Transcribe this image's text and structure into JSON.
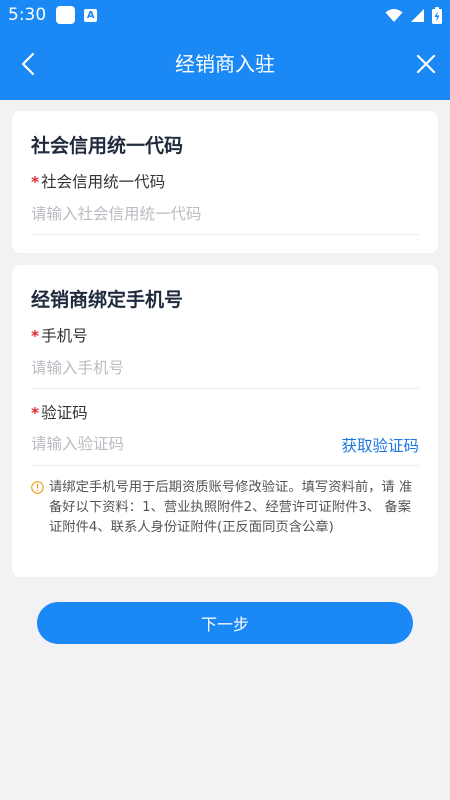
{
  "status_bar": {
    "time": "5:30",
    "app_a_label": "A"
  },
  "header": {
    "title": "经销商入驻"
  },
  "credit_section": {
    "title": "社会信用统一代码",
    "required_mark": "*",
    "field_label": "社会信用统一代码",
    "field_placeholder": "请输入社会信用统一代码",
    "field_value": ""
  },
  "phone_section": {
    "title": "经销商绑定手机号",
    "phone_required_mark": "*",
    "phone_label": "手机号",
    "phone_placeholder": "请输入手机号",
    "phone_value": "",
    "code_required_mark": "*",
    "code_label": "验证码",
    "code_placeholder": "请输入验证码",
    "code_value": "",
    "get_code_label": "获取验证码",
    "notice_text": "请绑定手机号用于后期资质账号修改验证。填写资料前，请 准备好以下资料：1、营业执照附件2、经营许可证附件3、 备案证附件4、联系人身份证附件(正反面同页含公章)"
  },
  "footer": {
    "next_label": "下一步"
  },
  "colors": {
    "primary": "#1a88f5",
    "link": "#1a78e4",
    "required": "#e02a2a",
    "notice_icon": "#f0a020",
    "background": "#f2f2f4"
  },
  "icons": {
    "back": "back-arrow-icon",
    "close": "close-icon",
    "notice": "info-circle-icon",
    "wifi": "wifi-icon",
    "signal": "signal-icon",
    "battery": "battery-icon"
  }
}
